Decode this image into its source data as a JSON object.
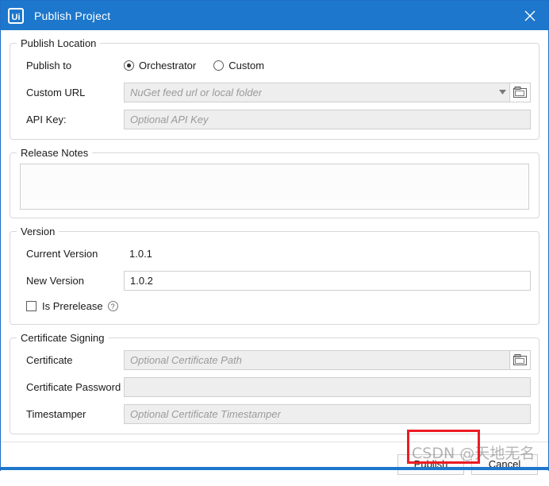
{
  "window": {
    "title": "Publish Project",
    "logo_text": "Ui",
    "close_icon": "close-icon"
  },
  "publish_location": {
    "group_label": "Publish Location",
    "publish_to_label": "Publish to",
    "radios": [
      {
        "label": "Orchestrator",
        "selected": true
      },
      {
        "label": "Custom",
        "selected": false
      }
    ],
    "custom_url_label": "Custom URL",
    "custom_url_placeholder": "NuGet feed url or local folder",
    "custom_url_value": "",
    "api_key_label": "API Key:",
    "api_key_placeholder": "Optional API Key",
    "api_key_value": "",
    "browse_icon": "folder-icon",
    "dropdown_icon": "chevron-down-icon"
  },
  "release_notes": {
    "group_label": "Release Notes",
    "value": ""
  },
  "version": {
    "group_label": "Version",
    "current_version_label": "Current Version",
    "current_version_value": "1.0.1",
    "new_version_label": "New Version",
    "new_version_value": "1.0.2",
    "prerelease_label": "Is Prerelease",
    "prerelease_checked": false,
    "help_icon_glyph": "?"
  },
  "certificate_signing": {
    "group_label": "Certificate Signing",
    "certificate_label": "Certificate",
    "certificate_placeholder": "Optional Certificate Path",
    "certificate_value": "",
    "password_label": "Certificate Password",
    "password_placeholder": "",
    "password_value": "",
    "timestamper_label": "Timestamper",
    "timestamper_placeholder": "Optional Certificate Timestamper",
    "timestamper_value": "",
    "browse_icon": "folder-icon"
  },
  "footer": {
    "publish_label": "Publish",
    "cancel_label": "Cancel"
  },
  "overlay": {
    "watermark_text": "CSDN @天地无名",
    "highlight_color": "#ed1c24"
  },
  "colors": {
    "titlebar": "#1d77cc",
    "accent": "#1d77cc",
    "disabled_field": "#eeeeee"
  }
}
